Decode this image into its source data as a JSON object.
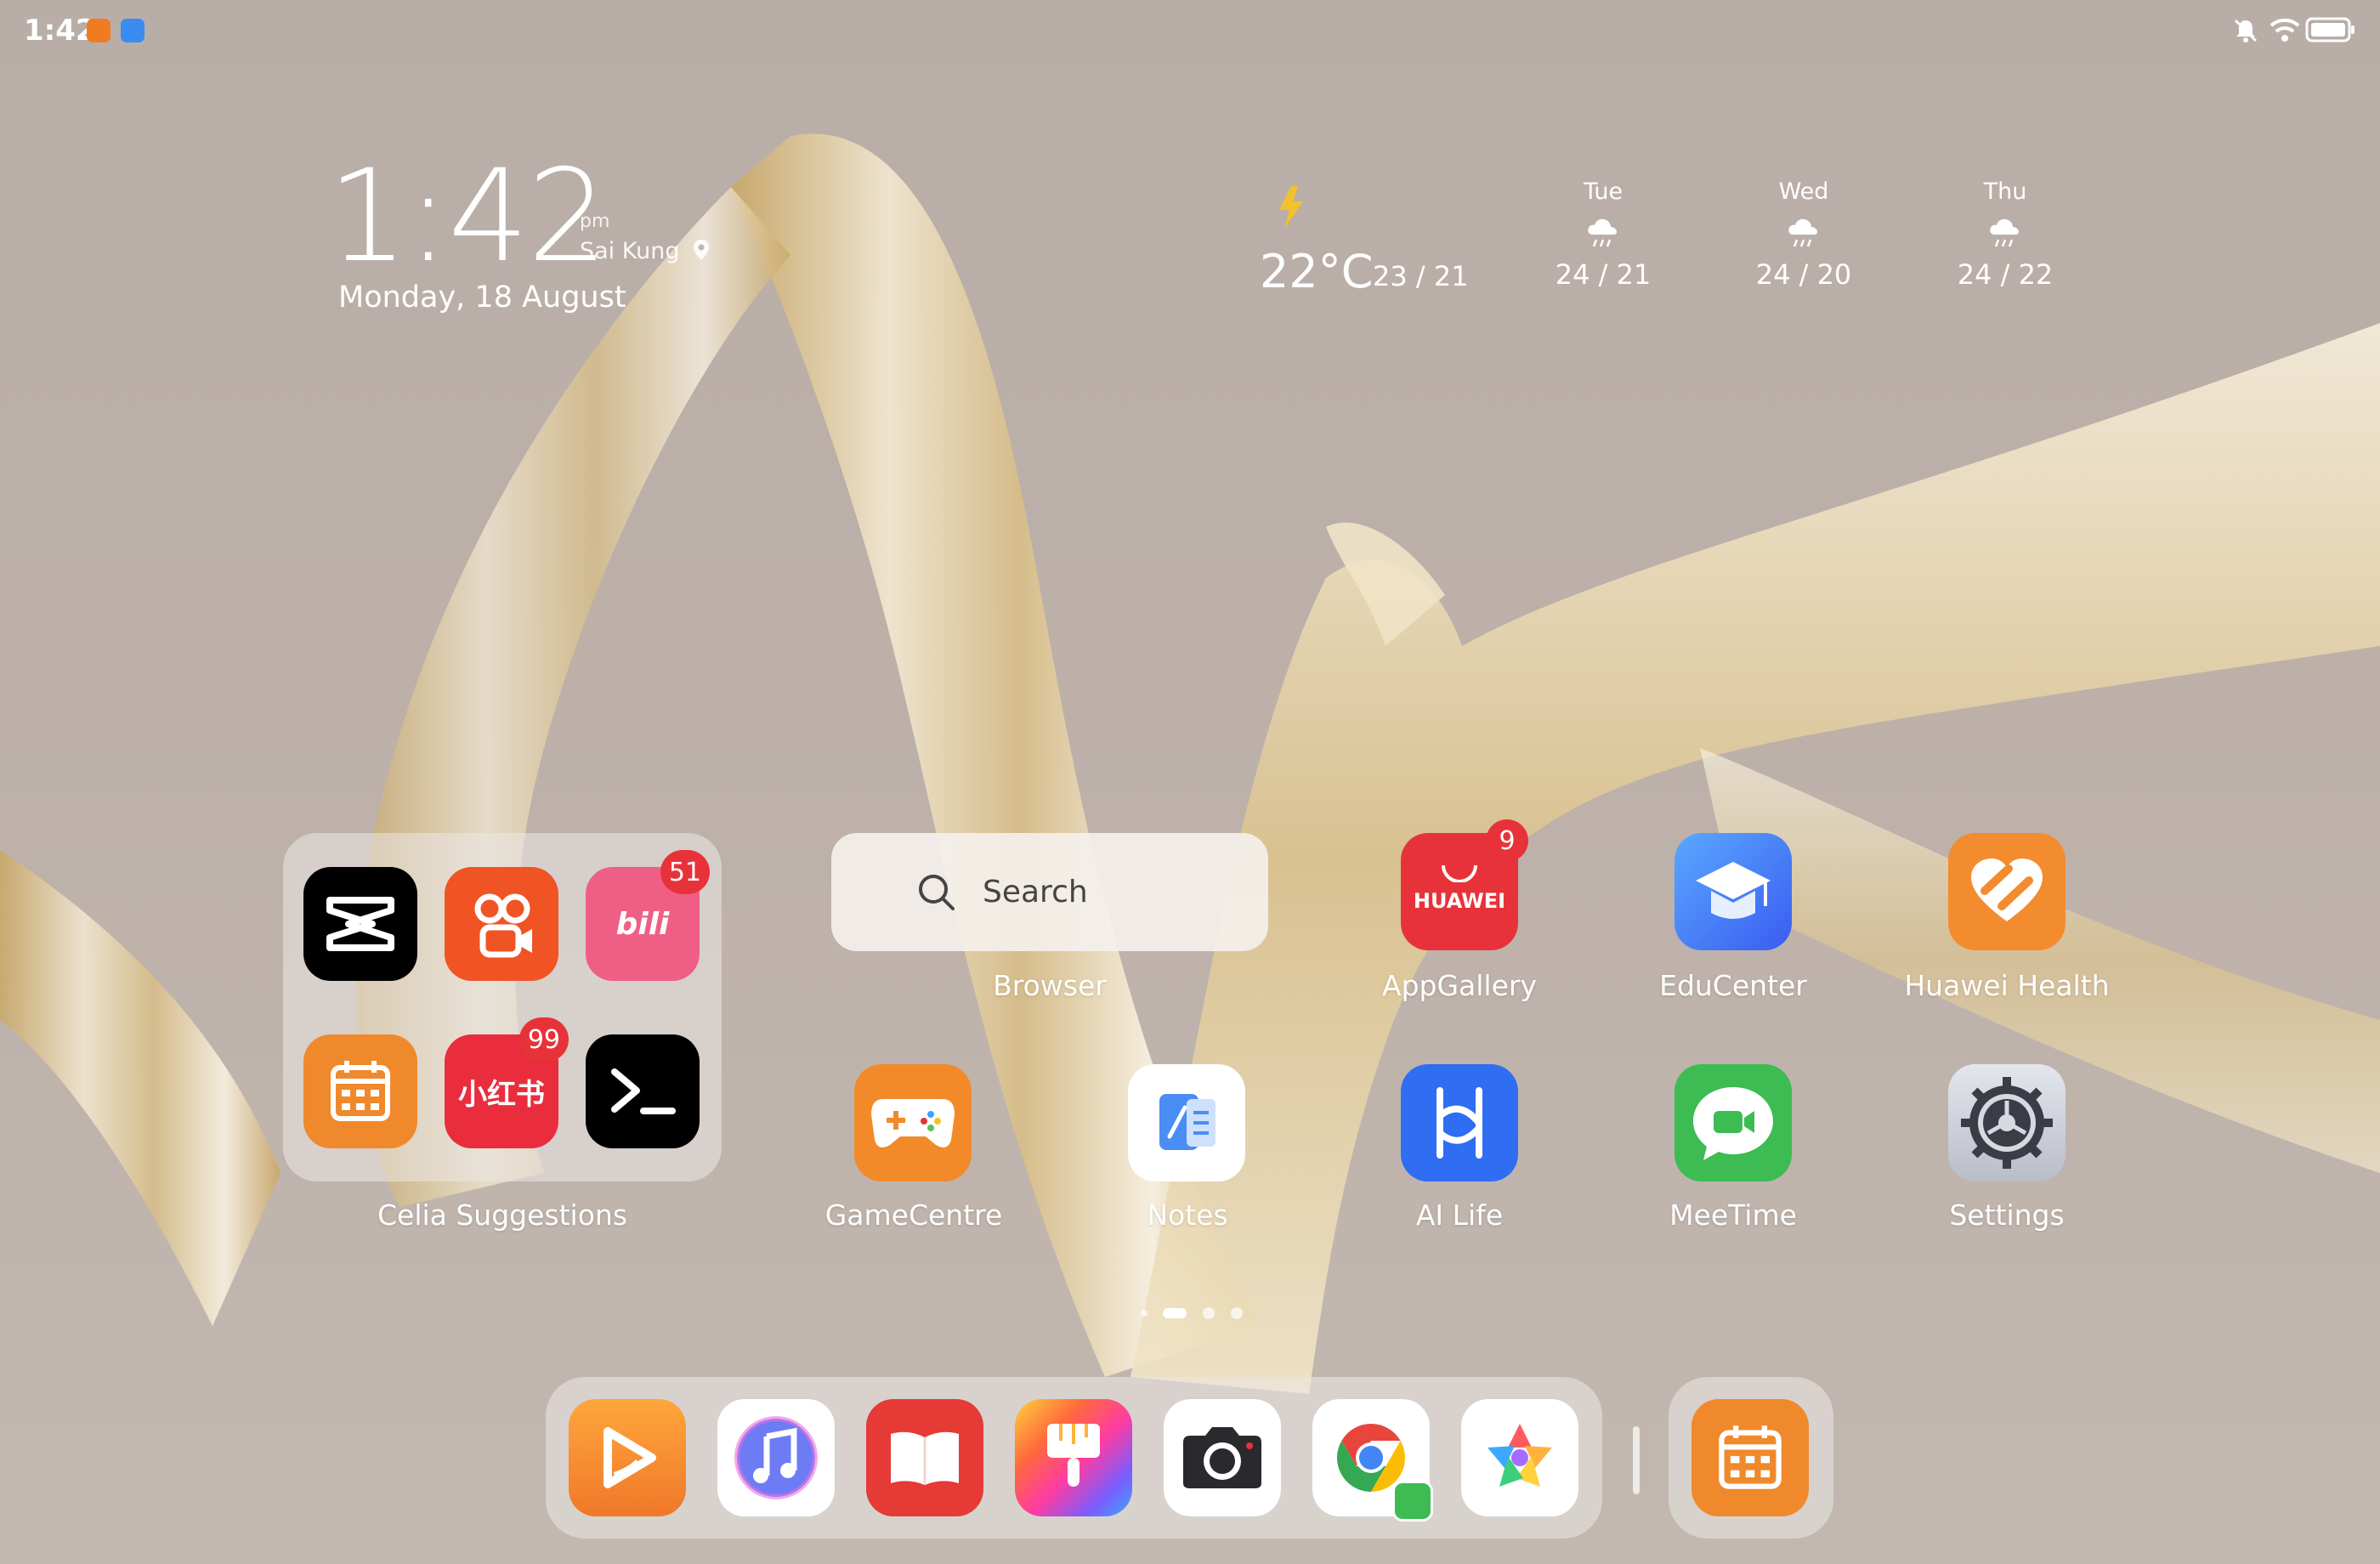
{
  "status_bar": {
    "time": "1:42",
    "icons": [
      "weibo-notification-icon",
      "browser-notification-icon",
      "mute-bell-icon",
      "wifi-icon",
      "battery-icon"
    ]
  },
  "clock": {
    "time": "1:42",
    "ampm": "pm",
    "city": "Sai Kung",
    "date": "Monday, 18 August"
  },
  "weather": {
    "current_temp": "22°C",
    "current_range": "23 / 21",
    "forecast": [
      {
        "day": "Tue",
        "range": "24 / 21"
      },
      {
        "day": "Wed",
        "range": "24 / 20"
      },
      {
        "day": "Thu",
        "range": "24 / 22"
      }
    ]
  },
  "folder": {
    "label": "Celia Suggestions",
    "bilibili_badge": "51",
    "xiaohongshu_badge": "99"
  },
  "search": {
    "placeholder": "Search",
    "label": "Browser"
  },
  "apps": {
    "appgallery": {
      "label": "AppGallery",
      "badge": "9",
      "brand_text": "HUAWEI"
    },
    "educenter": {
      "label": "EduCenter"
    },
    "health": {
      "label": "Huawei Health"
    },
    "gamecentre": {
      "label": "GameCentre"
    },
    "notes": {
      "label": "Notes"
    },
    "ailife": {
      "label": "AI Life"
    },
    "meetime": {
      "label": "MeeTime"
    },
    "settings": {
      "label": "Settings"
    }
  },
  "page_indicator": {
    "pages": 4,
    "current": 1
  },
  "colors": {
    "badge": "#e8323a",
    "wallpaper": "#bcb0a9"
  }
}
